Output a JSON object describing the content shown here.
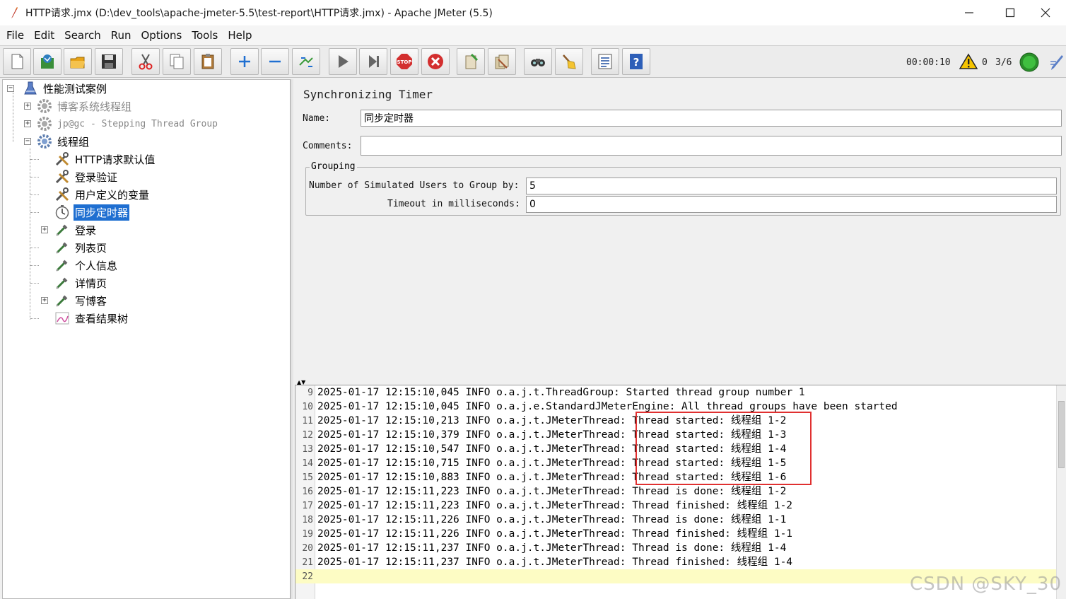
{
  "window": {
    "title": "HTTP请求.jmx (D:\\dev_tools\\apache-jmeter-5.5\\test-report\\HTTP请求.jmx) - Apache JMeter (5.5)"
  },
  "menu": [
    "File",
    "Edit",
    "Search",
    "Run",
    "Options",
    "Tools",
    "Help"
  ],
  "toolbar": {
    "buttons": [
      {
        "name": "new-icon"
      },
      {
        "name": "templates-icon"
      },
      {
        "name": "open-icon"
      },
      {
        "name": "save-icon"
      },
      {
        "name": "cut-icon"
      },
      {
        "name": "copy-icon"
      },
      {
        "name": "paste-icon"
      },
      {
        "name": "expand-icon"
      },
      {
        "name": "collapse-icon"
      },
      {
        "name": "toggle-icon"
      },
      {
        "name": "start-icon"
      },
      {
        "name": "start-no-pause-icon"
      },
      {
        "name": "stop-icon"
      },
      {
        "name": "shutdown-icon"
      },
      {
        "name": "clear-icon"
      },
      {
        "name": "clear-all-icon"
      },
      {
        "name": "search-icon"
      },
      {
        "name": "reset-search-icon"
      },
      {
        "name": "function-helper-icon"
      },
      {
        "name": "help-icon"
      }
    ],
    "timer": "00:00:10",
    "warnings": "0",
    "threads": "3/6"
  },
  "tree": {
    "root": "性能测试案例",
    "items": [
      {
        "label": "博客系统线程组",
        "disabled": true
      },
      {
        "label": "jp@gc - Stepping Thread Group",
        "disabled": true
      },
      {
        "label": "线程组"
      },
      {
        "label": "HTTP请求默认值"
      },
      {
        "label": "登录验证"
      },
      {
        "label": "用户定义的变量"
      },
      {
        "label": "同步定时器",
        "selected": true
      },
      {
        "label": "登录"
      },
      {
        "label": "列表页"
      },
      {
        "label": "个人信息"
      },
      {
        "label": "详情页"
      },
      {
        "label": "写博客"
      },
      {
        "label": "查看结果树"
      }
    ]
  },
  "panel": {
    "title": "Synchronizing Timer",
    "name_label": "Name:",
    "name_value": "同步定时器",
    "comments_label": "Comments:",
    "comments_value": "",
    "group_title": "Grouping",
    "users_label": "Number of Simulated Users to Group by:",
    "users_value": "5",
    "timeout_label": "Timeout in milliseconds:",
    "timeout_value": "0"
  },
  "log": {
    "lines": [
      {
        "n": "9",
        "text": "2025-01-17 12:15:10,045 INFO o.a.j.t.ThreadGroup: Started thread group number 1"
      },
      {
        "n": "10",
        "text": "2025-01-17 12:15:10,045 INFO o.a.j.e.StandardJMeterEngine: All thread groups have been started"
      },
      {
        "n": "11",
        "text": "2025-01-17 12:15:10,213 INFO o.a.j.t.JMeterThread: Thread started: 线程组 1-2"
      },
      {
        "n": "12",
        "text": "2025-01-17 12:15:10,379 INFO o.a.j.t.JMeterThread: Thread started: 线程组 1-3"
      },
      {
        "n": "13",
        "text": "2025-01-17 12:15:10,547 INFO o.a.j.t.JMeterThread: Thread started: 线程组 1-4"
      },
      {
        "n": "14",
        "text": "2025-01-17 12:15:10,715 INFO o.a.j.t.JMeterThread: Thread started: 线程组 1-5"
      },
      {
        "n": "15",
        "text": "2025-01-17 12:15:10,883 INFO o.a.j.t.JMeterThread: Thread started: 线程组 1-6"
      },
      {
        "n": "16",
        "text": "2025-01-17 12:15:11,223 INFO o.a.j.t.JMeterThread: Thread is done: 线程组 1-2"
      },
      {
        "n": "17",
        "text": "2025-01-17 12:15:11,223 INFO o.a.j.t.JMeterThread: Thread finished: 线程组 1-2"
      },
      {
        "n": "18",
        "text": "2025-01-17 12:15:11,226 INFO o.a.j.t.JMeterThread: Thread is done: 线程组 1-1"
      },
      {
        "n": "19",
        "text": "2025-01-17 12:15:11,226 INFO o.a.j.t.JMeterThread: Thread finished: 线程组 1-1"
      },
      {
        "n": "20",
        "text": "2025-01-17 12:15:11,237 INFO o.a.j.t.JMeterThread: Thread is done: 线程组 1-4"
      },
      {
        "n": "21",
        "text": "2025-01-17 12:15:11,237 INFO o.a.j.t.JMeterThread: Thread finished: 线程组 1-4"
      },
      {
        "n": "22",
        "text": ""
      }
    ]
  },
  "watermark": "CSDN @SKY_30",
  "colors": {
    "selection": "#1f6fd1",
    "highlight_box": "#e03030",
    "current_line": "#fdfcc4"
  }
}
